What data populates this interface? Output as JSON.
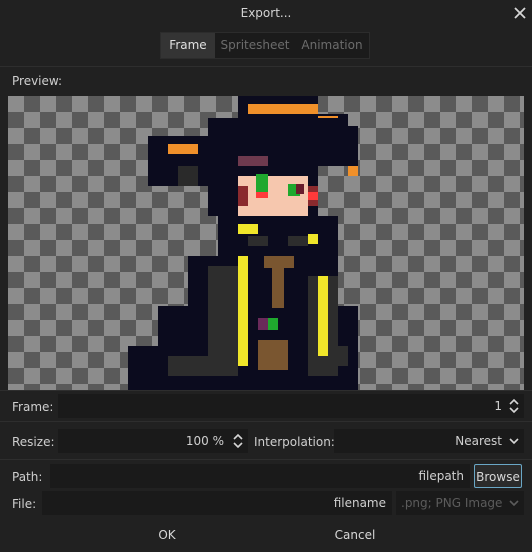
{
  "dialog": {
    "title": "Export..."
  },
  "icons": {
    "close": "close-icon",
    "spin": "spinner-icon",
    "dropdown": "chevron-down-icon"
  },
  "tabs": [
    {
      "label": "Frame",
      "active": true
    },
    {
      "label": "Spritesheet",
      "active": false
    },
    {
      "label": "Animation",
      "active": false
    }
  ],
  "preview": {
    "label": "Preview:"
  },
  "frame": {
    "label": "Frame:",
    "value": "1"
  },
  "resize": {
    "label": "Resize:",
    "value": "100 %"
  },
  "interpolation": {
    "label": "Interpolation:",
    "value": "Nearest"
  },
  "path": {
    "label": "Path:",
    "value": "filepath",
    "browse_label": "Browse"
  },
  "file": {
    "label": "File:",
    "value": "filename",
    "format": ".png; PNG Image"
  },
  "actions": {
    "ok_label": "OK",
    "cancel_label": "Cancel"
  },
  "colors": {
    "accent": "#6aa7c6",
    "background": "#212121",
    "checker_light": "#8c8c8c",
    "checker_dark": "#5a5a5a"
  }
}
